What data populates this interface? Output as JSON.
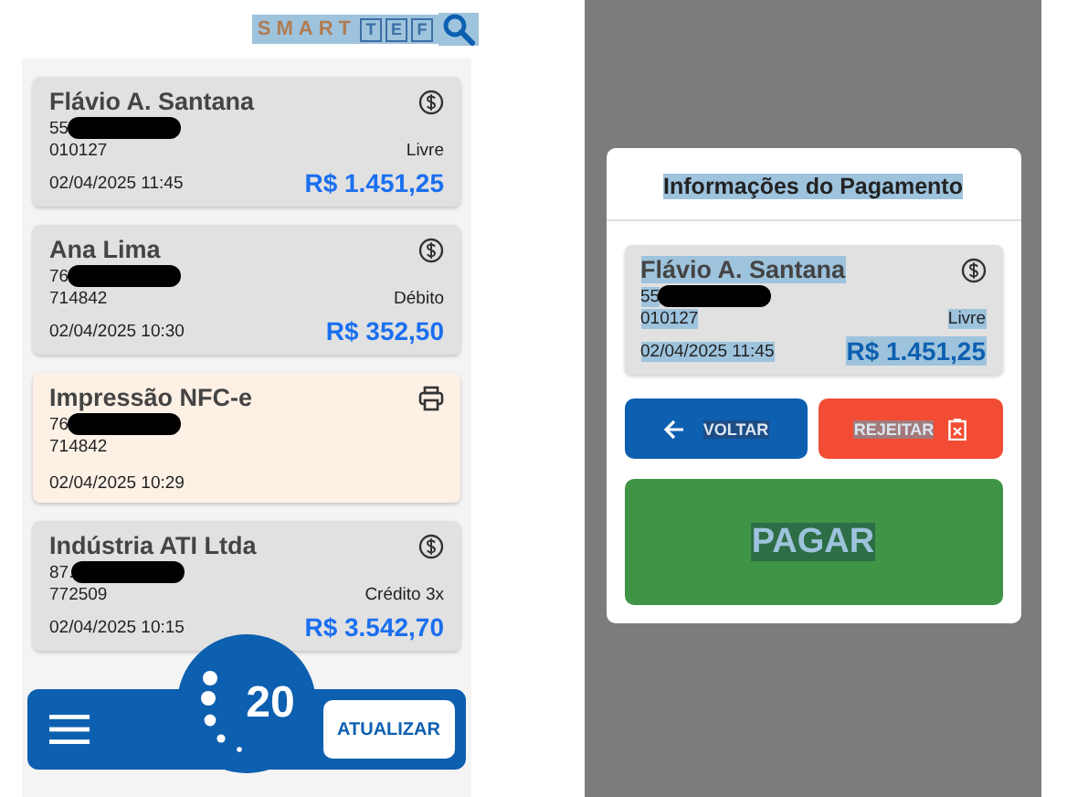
{
  "header": {
    "logo_text": "SMART",
    "logo_boxes": [
      "T",
      "E",
      "F"
    ]
  },
  "cards": [
    {
      "kind": "payment",
      "name": "Flávio A. Santana",
      "doc": "55",
      "code": "010127",
      "method": "Livre",
      "date": "02/04/2025 11:45",
      "amount": "R$ 1.451,25"
    },
    {
      "kind": "payment",
      "name": "Ana Lima",
      "doc": "76",
      "code": "714842",
      "method": "Débito",
      "date": "02/04/2025 10:30",
      "amount": "R$ 352,50"
    },
    {
      "kind": "print",
      "name": "Impressão NFC-e",
      "doc": "76",
      "code": "714842",
      "date": "02/04/2025 10:29"
    },
    {
      "kind": "payment",
      "name": "Indústria ATI Ltda",
      "doc": "87.",
      "code": "772509",
      "method": "Crédito 3x",
      "date": "02/04/2025 10:15",
      "amount": "R$ 3.542,70"
    }
  ],
  "bottom_bar": {
    "count": "20",
    "refresh_button": "ATUALIZAR"
  },
  "dialog": {
    "title": "Informações do Pagamento",
    "card": {
      "name": "Flávio A. Santana",
      "doc": "55",
      "code": "010127",
      "method": "Livre",
      "date": "02/04/2025 11:45",
      "amount": "R$ 1.451,25"
    },
    "back_button": "VOLTAR",
    "reject_button": "REJEITAR",
    "pay_button": "PAGAR"
  }
}
